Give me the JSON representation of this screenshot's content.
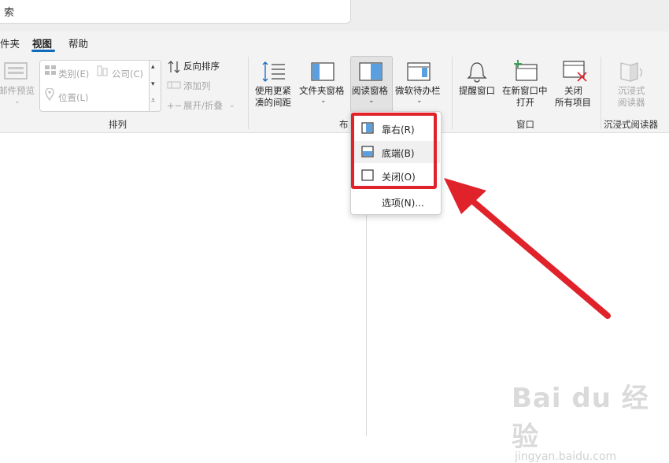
{
  "search": {
    "text": "索"
  },
  "tabs": [
    {
      "label": "件夹"
    },
    {
      "label": "视图"
    },
    {
      "label": "帮助"
    }
  ],
  "arrange": {
    "preview_label": "邮件预览",
    "category": "类别(E)",
    "company": "公司(C)",
    "location": "位置(L)",
    "reverse_sort": "反向排序",
    "add_column": "添加列",
    "expand_collapse": "展开/折叠",
    "group_label": "排列"
  },
  "layout": {
    "compact_l1": "使用更紧",
    "compact_l2": "凑的间距",
    "folder_pane": "文件夹窗格",
    "reading_pane": "阅读窗格",
    "todo_bar": "微软待办栏",
    "group_label": "布"
  },
  "window": {
    "reminders": "提醒窗口",
    "new_window_l1": "在新窗口中",
    "new_window_l2": "打开",
    "close_all_l1": "关闭",
    "close_all_l2": "所有项目",
    "group_label": "窗口"
  },
  "immersive": {
    "btn_l1": "沉浸式",
    "btn_l2": "阅读器",
    "group_label": "沉浸式阅读器"
  },
  "menu": {
    "right": "靠右(R)",
    "bottom": "底端(B)",
    "off": "关闭(O)",
    "options": "选项(N)..."
  },
  "watermark": {
    "main": "Bai du 经验",
    "sub": "jingyan.baidu.com"
  },
  "colors": {
    "accent": "#0f6cbd",
    "highlight_red": "#e0232b",
    "pane_blue": "#5aa0e0"
  }
}
